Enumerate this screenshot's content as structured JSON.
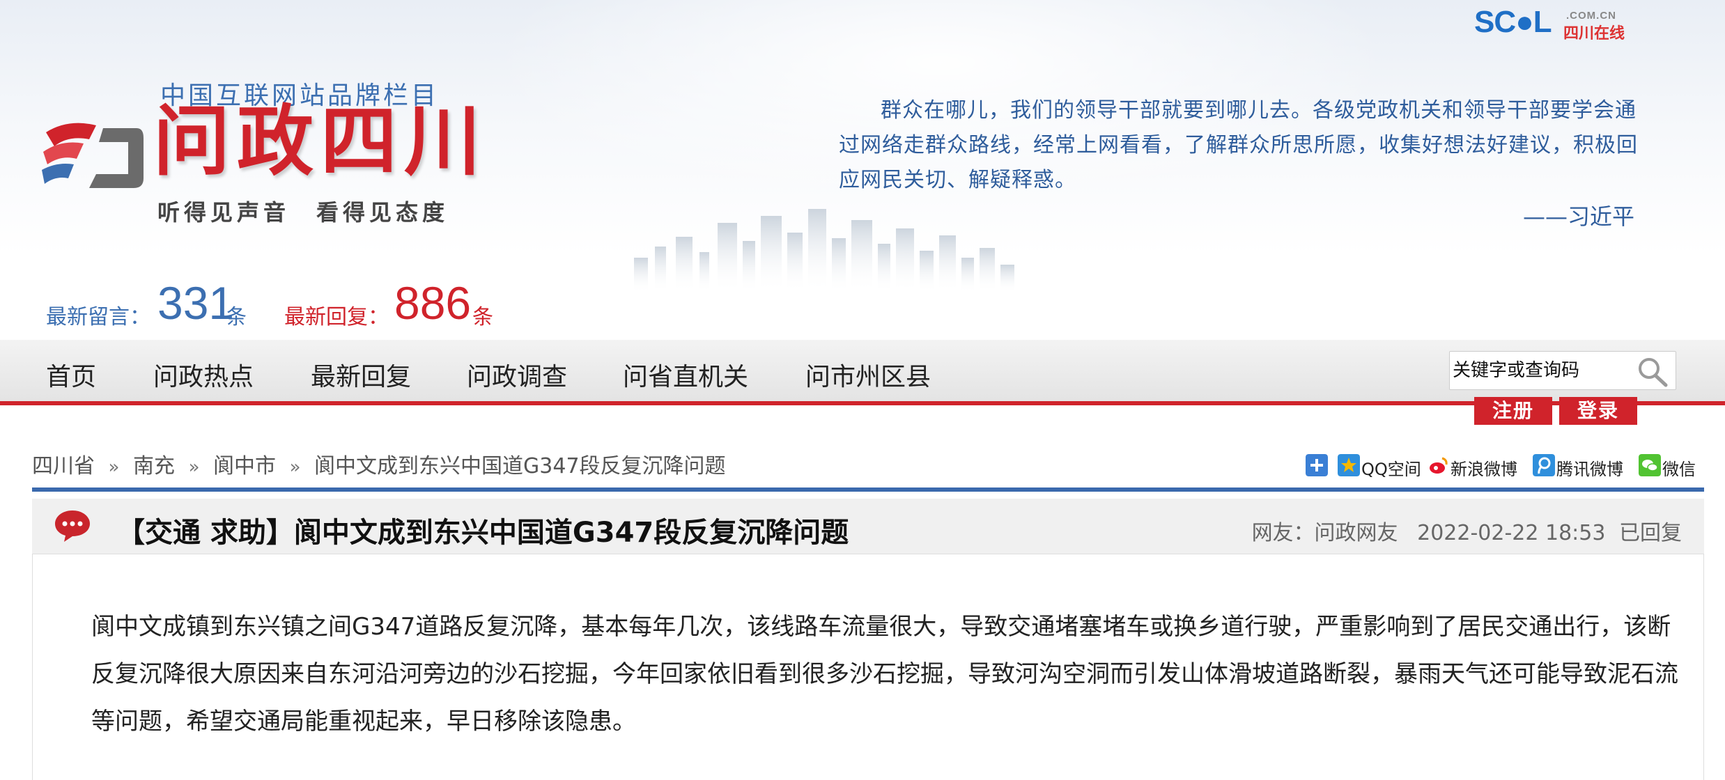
{
  "site": {
    "scol_logo": "SC●L",
    "scol_domain": ".COM.CN",
    "scol_cn": "四川在线",
    "brand_top": "中国互联网站品牌栏目",
    "brand_title": "问政四川",
    "brand_slogan": "听得见声音　看得见态度",
    "quote": "群众在哪儿，我们的领导干部就要到哪儿去。各级党政机关和领导干部要学会通过网络走群众路线，经常上网看看，了解群众所思所愿，收集好想法好建议，积极回应网民关切、解疑释惑。",
    "quote_author": "——习近平"
  },
  "stats": {
    "latest_messages_label": "最新留言：",
    "latest_messages_count": "331",
    "latest_messages_unit": "条",
    "latest_replies_label": "最新回复：",
    "latest_replies_count": "886",
    "latest_replies_unit": "条"
  },
  "nav": {
    "items": [
      {
        "label": "首页"
      },
      {
        "label": "问政热点"
      },
      {
        "label": "最新回复"
      },
      {
        "label": "问政调查"
      },
      {
        "label": "问省直机关"
      },
      {
        "label": "问市州区县"
      }
    ],
    "search_placeholder": "关键字或查询码",
    "register_label": "注册",
    "login_label": "登录"
  },
  "breadcrumb": {
    "items": [
      "四川省",
      "南充",
      "阆中市",
      "阆中文成到东兴中国道G347段反复沉降问题"
    ],
    "separator": "»"
  },
  "share": {
    "items": [
      {
        "label": "",
        "icon": "plus-icon",
        "color": "#3a7fd5"
      },
      {
        "label": "QQ空间",
        "icon": "qzone-icon",
        "color": "#f5b800"
      },
      {
        "label": "新浪微博",
        "icon": "weibo-icon",
        "color": "#e6162d"
      },
      {
        "label": "腾讯微博",
        "icon": "tencent-weibo-icon",
        "color": "#2f8fdc"
      },
      {
        "label": "微信",
        "icon": "wechat-icon",
        "color": "#51c332"
      }
    ]
  },
  "post": {
    "title": "【交通 求助】阆中文成到东兴中国道G347段反复沉降问题",
    "author_label": "网友：问政网友",
    "datetime": "2022-02-22 18:53",
    "status": "已回复",
    "content": "阆中文成镇到东兴镇之间G347道路反复沉降，基本每年几次，该线路车流量很大，导致交通堵塞堵车或换乡道行驶，严重影响到了居民交通出行，该断反复沉降很大原因来自东河沿河旁边的沙石挖掘，今年回家依旧看到很多沙石挖掘，导致河沟空洞而引发山体滑坡道路断裂，暴雨天气还可能导致泥石流等问题，希望交通局能重视起来，早日移除该隐患。"
  },
  "colors": {
    "brand_red": "#d0232b",
    "brand_blue": "#3c6fb1",
    "divider_blue": "#3a69ad"
  }
}
